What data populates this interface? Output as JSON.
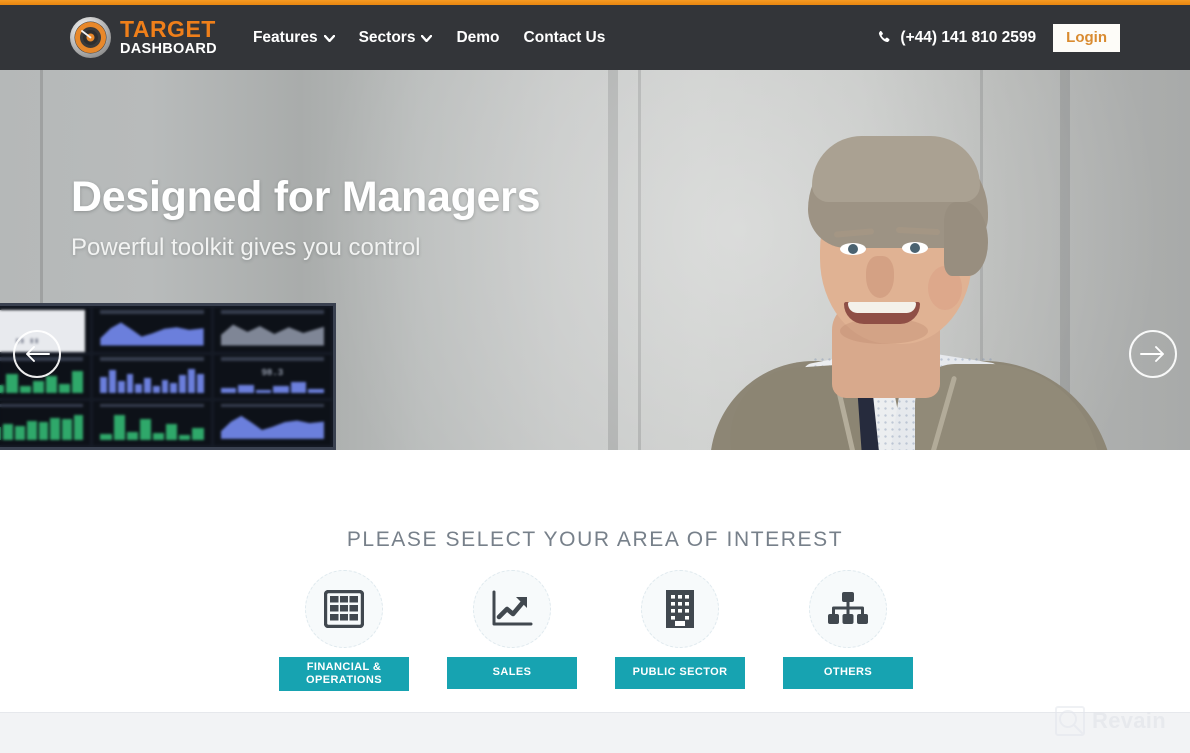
{
  "brand": {
    "logo_icon": "target-dial-icon",
    "name_primary": "TARGET",
    "name_secondary": "DASHBOARD",
    "primary_color": "#ef7f1a",
    "nav_bg_color": "#333539",
    "accent_color": "#17a3b1"
  },
  "nav": {
    "items": [
      {
        "label": "Features",
        "has_dropdown": true
      },
      {
        "label": "Sectors",
        "has_dropdown": true
      },
      {
        "label": "Demo",
        "has_dropdown": false
      },
      {
        "label": "Contact Us",
        "has_dropdown": false
      }
    ],
    "phone_icon": "phone-icon",
    "phone": "(+44) 141 810 2599",
    "login_label": "Login"
  },
  "hero": {
    "title": "Designed for Managers",
    "subtitle": "Powerful toolkit gives you control",
    "prev_icon": "arrow-left-icon",
    "next_icon": "arrow-right-icon",
    "image_description": "Smiling middle-aged man in grey waistcoat standing in office beside a wall of dashboard monitors"
  },
  "interest": {
    "heading": "PLEASE SELECT YOUR AREA OF INTEREST",
    "cards": [
      {
        "icon": "table-grid-icon",
        "label": "FINANCIAL & OPERATIONS"
      },
      {
        "icon": "line-chart-up-icon",
        "label": "SALES"
      },
      {
        "icon": "office-building-icon",
        "label": "PUBLIC SECTOR"
      },
      {
        "icon": "org-chart-icon",
        "label": "OTHERS"
      }
    ]
  },
  "watermark": {
    "icon": "revain-magnifier-icon",
    "text": "Revain"
  }
}
